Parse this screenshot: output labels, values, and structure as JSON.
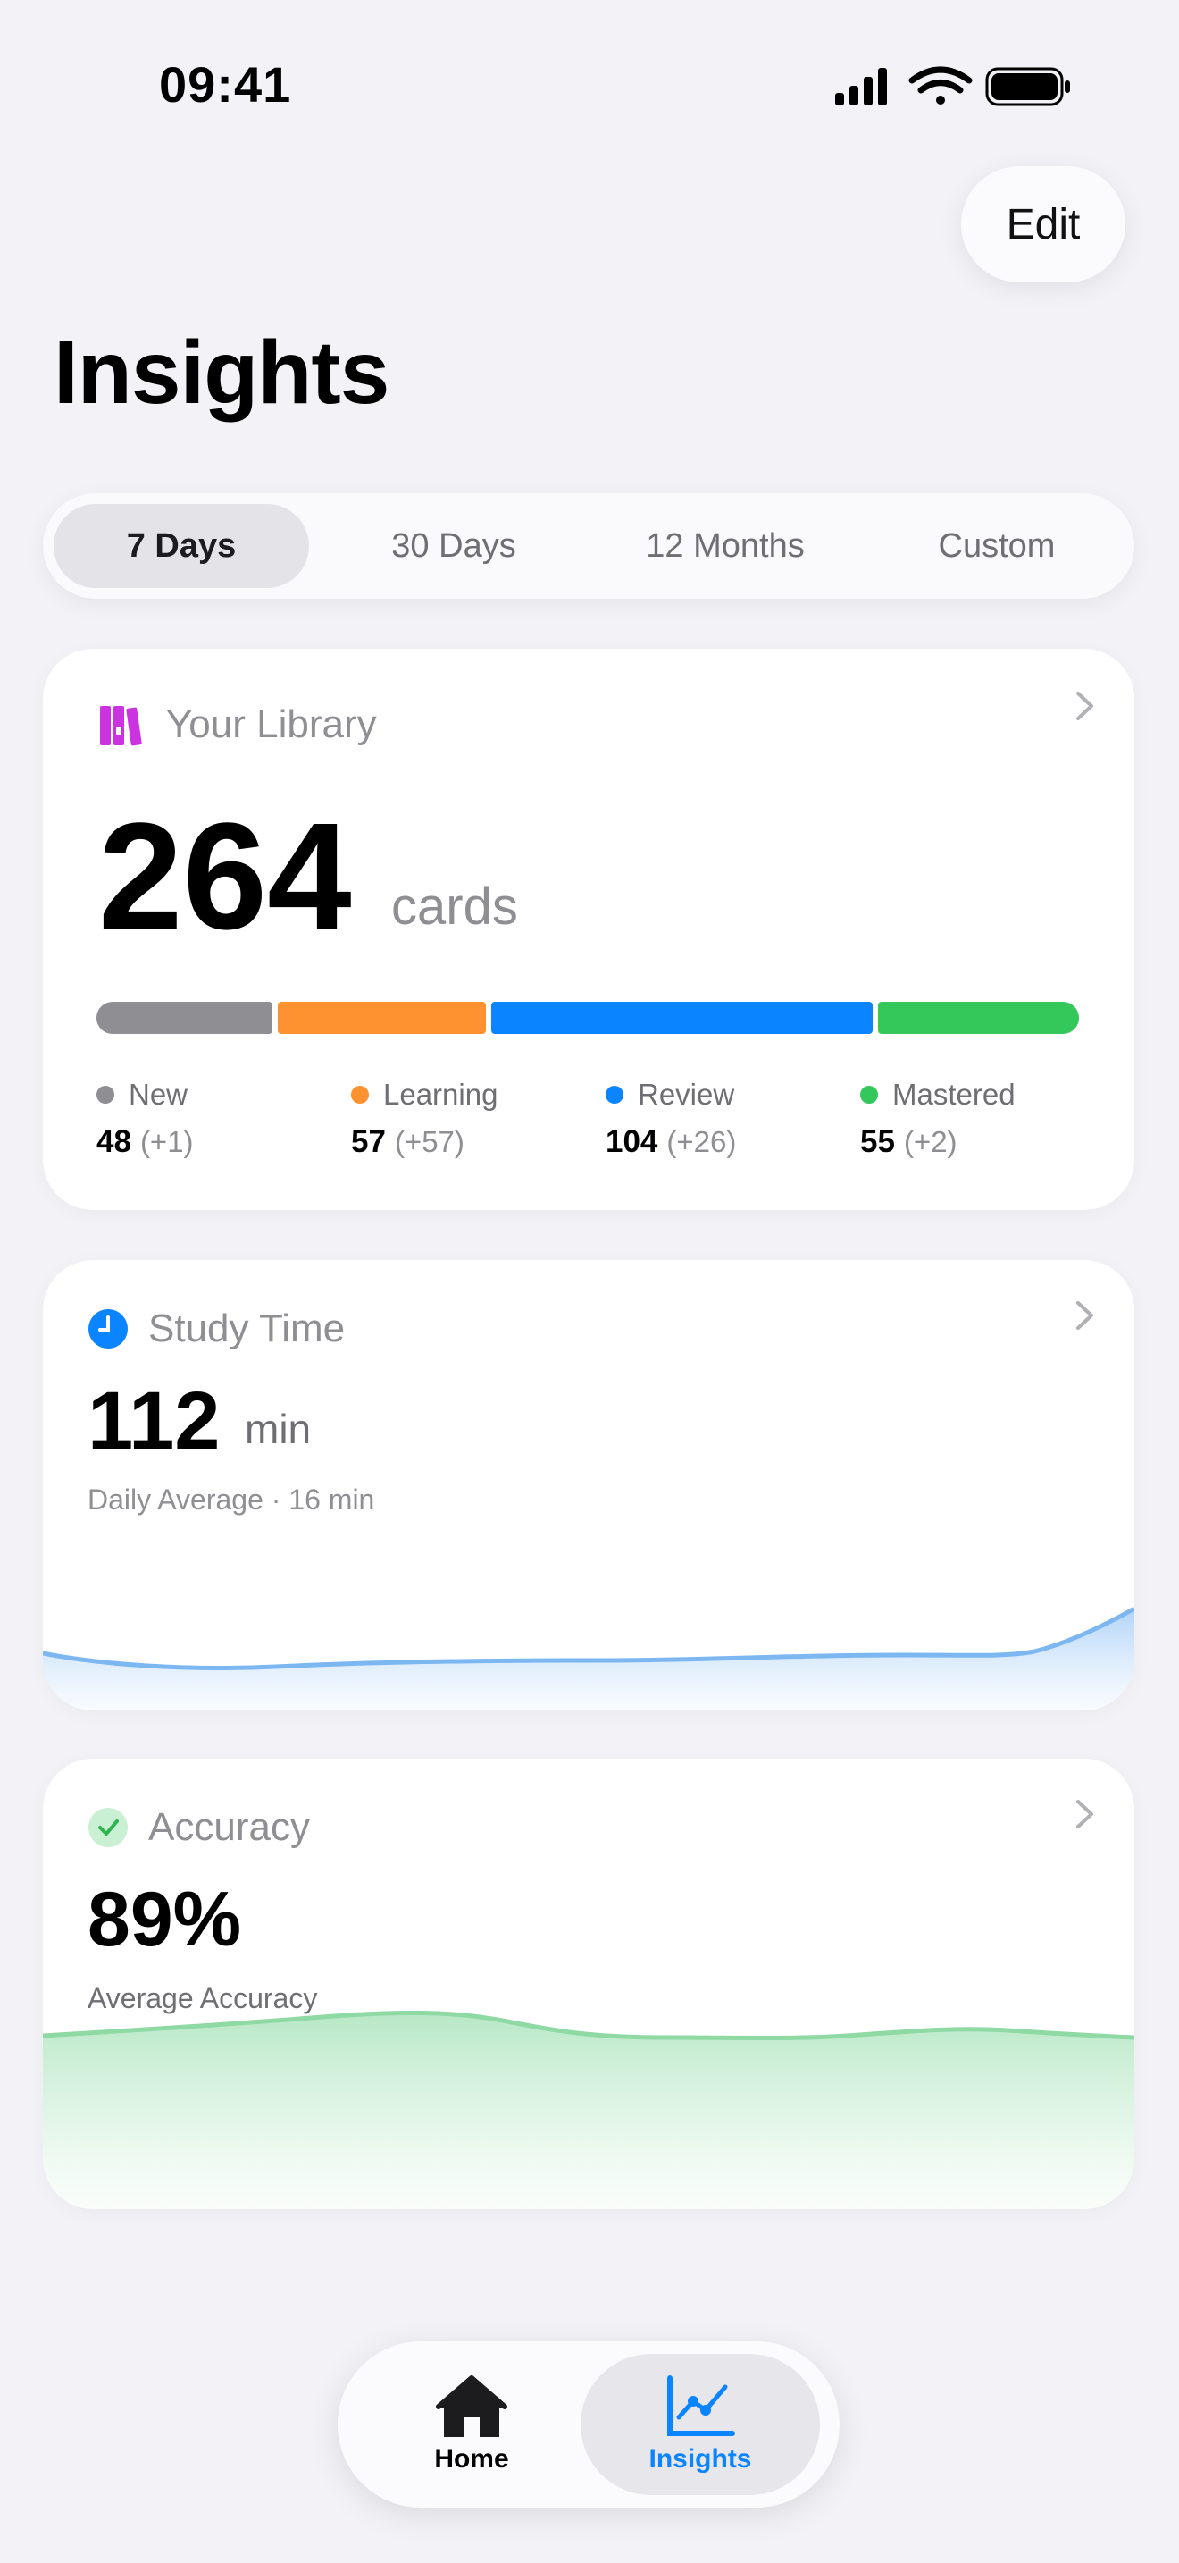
{
  "status_bar": {
    "time": "09:41"
  },
  "header": {
    "edit_label": "Edit",
    "title": "Insights"
  },
  "range_tabs": [
    {
      "label": "7 Days",
      "active": true
    },
    {
      "label": "30 Days",
      "active": false
    },
    {
      "label": "12 Months",
      "active": false
    },
    {
      "label": "Custom",
      "active": false
    }
  ],
  "library": {
    "title": "Your Library",
    "total": "264",
    "unit": "cards",
    "icon": "books-icon",
    "accent": "#cc33e0",
    "categories": [
      {
        "name": "New",
        "value": "48",
        "delta": "(+1)",
        "color": "#8e8e93"
      },
      {
        "name": "Learning",
        "value": "57",
        "delta": "(+57)",
        "color": "#ff9230"
      },
      {
        "name": "Review",
        "value": "104",
        "delta": "(+26)",
        "color": "#0a84ff"
      },
      {
        "name": "Mastered",
        "value": "55",
        "delta": "(+2)",
        "color": "#34c759"
      }
    ]
  },
  "study_time": {
    "title": "Study Time",
    "value": "112",
    "unit": "min",
    "subtitle": "Daily Average · 16 min",
    "icon": "clock-icon",
    "color": "#0a84ff"
  },
  "accuracy": {
    "title": "Accuracy",
    "value": "89%",
    "subtitle": "Average Accuracy",
    "icon": "checkmark-icon",
    "color": "#34c759"
  },
  "tab_bar": {
    "items": [
      {
        "label": "Home",
        "icon": "house-icon",
        "active": false
      },
      {
        "label": "Insights",
        "icon": "chart-icon",
        "active": true
      }
    ],
    "accent": "#0a84ff"
  }
}
